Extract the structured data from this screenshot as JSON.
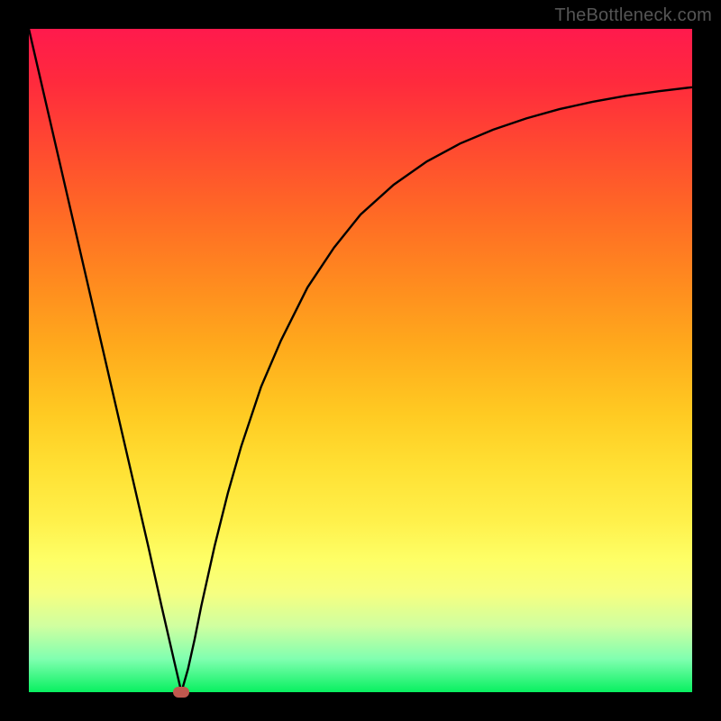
{
  "watermark": "TheBottleneck.com",
  "colors": {
    "frame": "#000000",
    "curve": "#000000",
    "marker": "#c0584e"
  },
  "chart_data": {
    "type": "line",
    "title": "",
    "xlabel": "",
    "ylabel": "",
    "xlim": [
      0,
      100
    ],
    "ylim": [
      0,
      100
    ],
    "grid": false,
    "legend": false,
    "marker": {
      "x": 23,
      "y": 0
    },
    "series": [
      {
        "name": "bottleneck-curve",
        "x": [
          0,
          3,
          6,
          9,
          12,
          15,
          18,
          20,
          22,
          23,
          24,
          25,
          26,
          28,
          30,
          32,
          35,
          38,
          42,
          46,
          50,
          55,
          60,
          65,
          70,
          75,
          80,
          85,
          90,
          95,
          100
        ],
        "y": [
          100,
          87,
          74,
          61,
          48,
          35,
          22,
          13,
          4.3,
          0,
          3.5,
          8,
          13,
          22,
          30,
          37,
          46,
          53,
          61,
          67,
          72,
          76.5,
          80,
          82.7,
          84.8,
          86.5,
          87.9,
          89,
          89.9,
          90.6,
          91.2
        ]
      }
    ]
  }
}
